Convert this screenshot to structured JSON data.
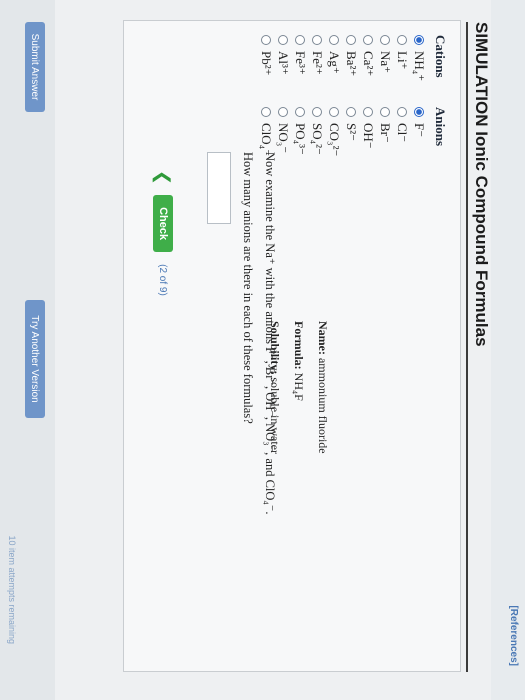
{
  "header": {
    "references_label": "[References]",
    "title": "SIMULATION  Ionic Compound Formulas"
  },
  "cations": {
    "heading": "Cations",
    "items": [
      {
        "label": "NH₄⁺",
        "selected": true
      },
      {
        "label": "Li⁺",
        "selected": false
      },
      {
        "label": "Na⁺",
        "selected": false
      },
      {
        "label": "Ca²⁺",
        "selected": false
      },
      {
        "label": "Ba²⁺",
        "selected": false
      },
      {
        "label": "Ag⁺",
        "selected": false
      },
      {
        "label": "Fe²⁺",
        "selected": false
      },
      {
        "label": "Fe³⁺",
        "selected": false
      },
      {
        "label": "Al³⁺",
        "selected": false
      },
      {
        "label": "Pb²⁺",
        "selected": false
      }
    ]
  },
  "anions": {
    "heading": "Anions",
    "items": [
      {
        "label": "F⁻",
        "selected": true
      },
      {
        "label": "Cl⁻",
        "selected": false
      },
      {
        "label": "Br⁻",
        "selected": false
      },
      {
        "label": "OH⁻",
        "selected": false
      },
      {
        "label": "S²⁻",
        "selected": false
      },
      {
        "label": "CO₃²⁻",
        "selected": false
      },
      {
        "label": "SO₄²⁻",
        "selected": false
      },
      {
        "label": "PO₄³⁻",
        "selected": false
      },
      {
        "label": "NO₃⁻",
        "selected": false
      },
      {
        "label": "ClO₄⁻",
        "selected": false
      }
    ]
  },
  "result": {
    "name_label": "Name:",
    "name_value": "ammonium fluoride",
    "formula_label": "Formula:",
    "formula_value": "NH₄F",
    "solubility_label": "Solubility:",
    "solubility_value": "soluble in water"
  },
  "question": {
    "line1": "Now examine the Na⁺ with the anions F⁻, Br⁻, OH⁻, NO₃⁻, and ClO₄⁻.",
    "line2": "How many anions are there in each of these formulas?",
    "answer_value": ""
  },
  "navigation": {
    "prev_symbol": "❮",
    "check_label": "Check",
    "counter": "(2 of 9)"
  },
  "footer": {
    "submit_label": "Submit Answer",
    "try_another_label": "Try Another Version",
    "attempts_text": "10 item attempts remaining"
  },
  "colors": {
    "accent_blue": "#2a66c9",
    "check_green": "#3fae49"
  }
}
